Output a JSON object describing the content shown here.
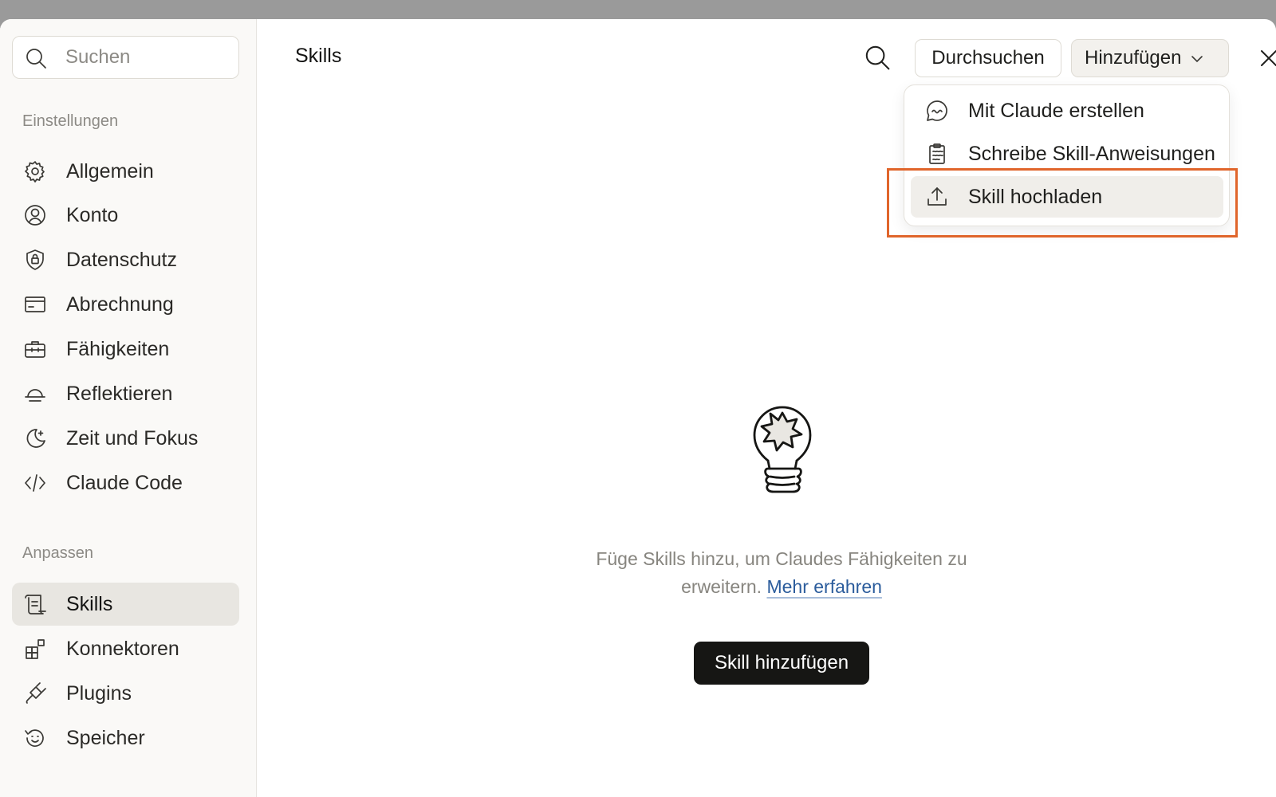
{
  "sidebar": {
    "search_placeholder": "Suchen",
    "section_settings": "Einstellungen",
    "section_customize": "Anpassen",
    "settings_items": [
      {
        "label": "Allgemein",
        "icon": "gear-icon"
      },
      {
        "label": "Konto",
        "icon": "user-circle-icon"
      },
      {
        "label": "Datenschutz",
        "icon": "shield-lock-icon"
      },
      {
        "label": "Abrechnung",
        "icon": "credit-card-icon"
      },
      {
        "label": "Fähigkeiten",
        "icon": "briefcase-icon"
      },
      {
        "label": "Reflektieren",
        "icon": "sunset-icon"
      },
      {
        "label": "Zeit und Fokus",
        "icon": "moon-sparkle-icon"
      },
      {
        "label": "Claude Code",
        "icon": "code-icon"
      }
    ],
    "customize_items": [
      {
        "label": "Skills",
        "icon": "scroll-icon",
        "active": true
      },
      {
        "label": "Konnektoren",
        "icon": "blocks-icon"
      },
      {
        "label": "Plugins",
        "icon": "plug-icon"
      },
      {
        "label": "Speicher",
        "icon": "history-icon"
      }
    ]
  },
  "header": {
    "title": "Skills",
    "browse_label": "Durchsuchen",
    "add_label": "Hinzufügen"
  },
  "dropdown": {
    "items": [
      {
        "label": "Mit Claude erstellen",
        "icon": "chat-bubble-icon"
      },
      {
        "label": "Schreibe Skill-Anweisungen",
        "icon": "clipboard-icon"
      },
      {
        "label": "Skill hochladen",
        "icon": "upload-icon",
        "highlighted": true
      }
    ]
  },
  "empty_state": {
    "text": "Füge Skills hinzu, um Claudes Fähigkeiten zu erweitern.",
    "link": "Mehr erfahren",
    "button": "Skill hinzufügen"
  },
  "colors": {
    "accent_highlight": "#e0652b",
    "link": "#2b5c9c",
    "primary_button": "#161614"
  }
}
